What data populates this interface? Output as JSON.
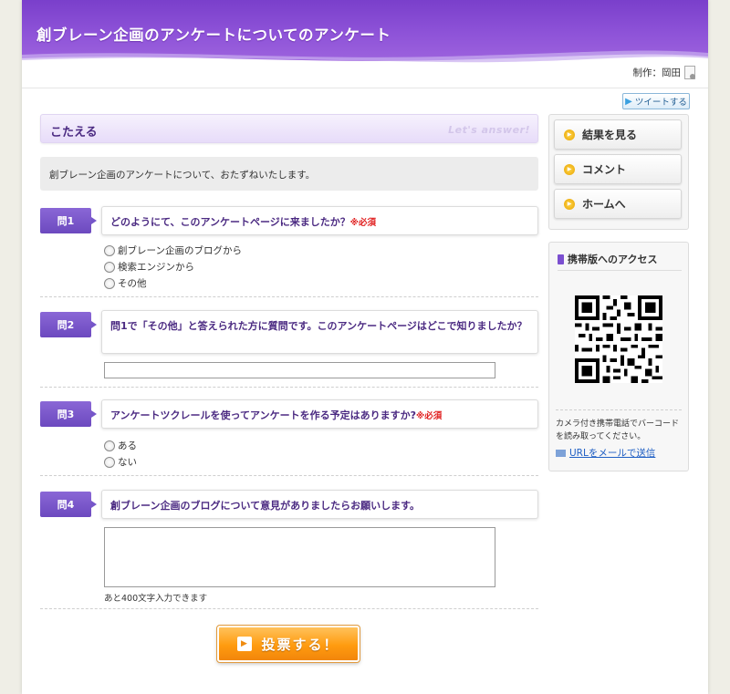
{
  "header": {
    "title": "創ブレーン企画のアンケートについてのアンケート",
    "author": "制作：岡田"
  },
  "tweet": {
    "label": "ツイートする"
  },
  "answer": {
    "heading": "こたえる",
    "heading_decoration": "Let's answer!",
    "intro": "創ブレーン企画のアンケートについて、おたずねいたします。"
  },
  "questions": [
    {
      "tag": "問1",
      "text": "どのようにて、このアンケートページに来ましたか？",
      "required": "※必須",
      "options": [
        "創ブレーン企画のブログから",
        "検索エンジンから",
        "その他"
      ]
    },
    {
      "tag": "問2",
      "text": "問1で「その他」と答えられた方に質問です。このアンケートページはどこで知りましたか？"
    },
    {
      "tag": "問3",
      "text": "アンケートツクレールを使ってアンケートを作る予定はありますか?",
      "required": "※必須",
      "options": [
        "ある",
        "ない"
      ]
    },
    {
      "tag": "問4",
      "text": "創ブレーン企画のブログについて意見がありましたらお願いします。",
      "char_count": "あと400文字入力できます"
    }
  ],
  "submit": {
    "label": "投票する！"
  },
  "sidebar": {
    "nav": [
      {
        "label": "結果を見る"
      },
      {
        "label": "コメント"
      },
      {
        "label": "ホームへ"
      }
    ],
    "mobile": {
      "title": "携帯版へのアクセス",
      "description": "カメラ付き携帯電話でバーコードを読み取ってください。",
      "link": "URLをメールで送信"
    }
  },
  "colors": {
    "header_purple": "#7a3fcb",
    "question_text": "#4b2a82",
    "required_red": "#e02020",
    "submit_orange": "#ff9b0f",
    "link_blue": "#1f5fc4"
  },
  "icons": [
    "twitter-bird-icon",
    "document-icon",
    "play-icon",
    "phone-icon",
    "qr-code",
    "mail-icon"
  ]
}
